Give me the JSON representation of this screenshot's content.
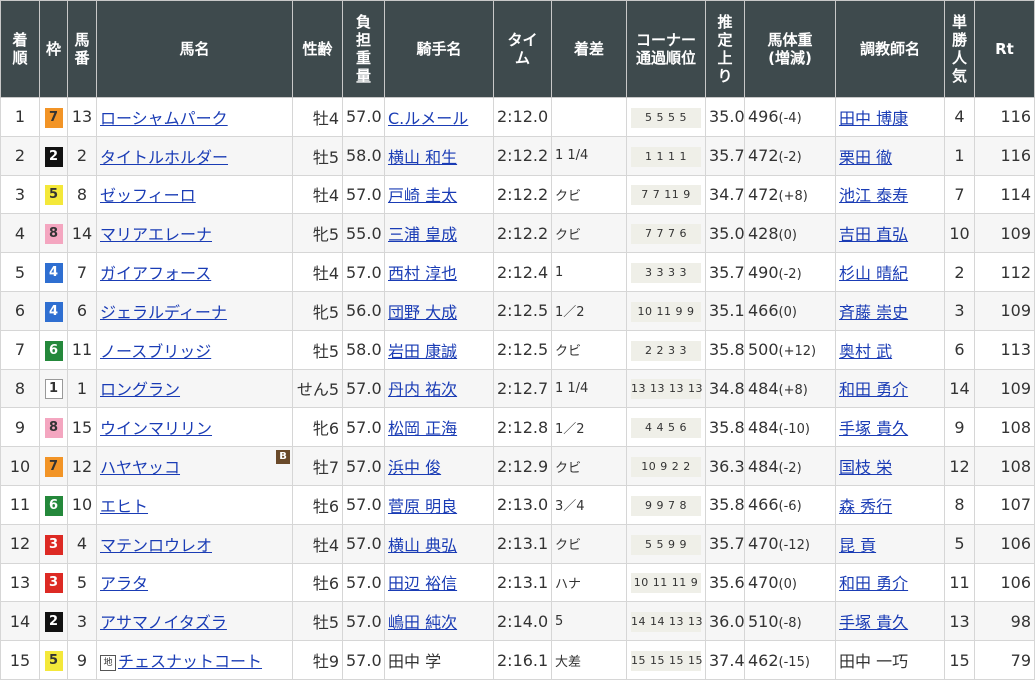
{
  "headers": [
    "着順",
    "枠",
    "馬番",
    "馬名",
    "性齢",
    "負担重量",
    "騎手名",
    "タイム",
    "着差",
    "コーナー通過順位",
    "推定上り",
    "馬体重(増減)",
    "調教師名",
    "単勝人気",
    "Rt"
  ],
  "header_display": {
    "rank": [
      "着",
      "順"
    ],
    "waku": [
      "枠"
    ],
    "num": [
      "馬",
      "番"
    ],
    "name": [
      "馬名"
    ],
    "sexage": [
      "性齢"
    ],
    "weight": [
      "負",
      "担",
      "重",
      "量"
    ],
    "jockey": [
      "騎手名"
    ],
    "time": [
      "タイ",
      "ム"
    ],
    "margin": [
      "着差"
    ],
    "corner": [
      "コーナー",
      "通過順位"
    ],
    "last3f": [
      "推",
      "定",
      "上",
      "り"
    ],
    "body": [
      "馬体重",
      "(増減)"
    ],
    "trainer": [
      "調教師名"
    ],
    "pop": [
      "単",
      "勝",
      "人",
      "気"
    ],
    "rt": [
      "Rt"
    ]
  },
  "rows": [
    {
      "rank": "1",
      "waku": "7",
      "num": "13",
      "name": "ローシャムパーク",
      "sexage": "牡4",
      "weight": "57.0",
      "jockey": "C.ルメール",
      "time": "2:12.0",
      "margin": "",
      "corner": "5 5 5 5",
      "last3f": "35.0",
      "body": "496",
      "diff": "(-4)",
      "trainer": "田中 博康",
      "pop": "4",
      "rt": "116",
      "jockey_link": true,
      "trainer_link": true
    },
    {
      "rank": "2",
      "waku": "2",
      "num": "2",
      "name": "タイトルホルダー",
      "sexage": "牡5",
      "weight": "58.0",
      "jockey": "横山 和生",
      "time": "2:12.2",
      "margin": "1 1/4",
      "corner": "1 1 1 1",
      "last3f": "35.7",
      "body": "472",
      "diff": "(-2)",
      "trainer": "栗田 徹",
      "pop": "1",
      "rt": "116",
      "jockey_link": true,
      "trainer_link": true
    },
    {
      "rank": "3",
      "waku": "5",
      "num": "8",
      "name": "ゼッフィーロ",
      "sexage": "牡4",
      "weight": "57.0",
      "jockey": "戸崎 圭太",
      "time": "2:12.2",
      "margin": "クビ",
      "corner": "7 7 11 9",
      "last3f": "34.7",
      "body": "472",
      "diff": "(+8)",
      "trainer": "池江 泰寿",
      "pop": "7",
      "rt": "114",
      "jockey_link": true,
      "trainer_link": true
    },
    {
      "rank": "4",
      "waku": "8",
      "num": "14",
      "name": "マリアエレーナ",
      "sexage": "牝5",
      "weight": "55.0",
      "jockey": "三浦 皇成",
      "time": "2:12.2",
      "margin": "クビ",
      "corner": "7 7 7 6",
      "last3f": "35.0",
      "body": "428",
      "diff": "(0)",
      "trainer": "吉田 直弘",
      "pop": "10",
      "rt": "109",
      "jockey_link": true,
      "trainer_link": true
    },
    {
      "rank": "5",
      "waku": "4",
      "num": "7",
      "name": "ガイアフォース",
      "sexage": "牡4",
      "weight": "57.0",
      "jockey": "西村 淳也",
      "time": "2:12.4",
      "margin": "1",
      "corner": "3 3 3 3",
      "last3f": "35.7",
      "body": "490",
      "diff": "(-2)",
      "trainer": "杉山 晴紀",
      "pop": "2",
      "rt": "112",
      "jockey_link": true,
      "trainer_link": true
    },
    {
      "rank": "6",
      "waku": "4",
      "num": "6",
      "name": "ジェラルディーナ",
      "sexage": "牝5",
      "weight": "56.0",
      "jockey": "団野 大成",
      "time": "2:12.5",
      "margin": "1／2",
      "corner": "10 11 9 9",
      "last3f": "35.1",
      "body": "466",
      "diff": "(0)",
      "trainer": "斉藤 崇史",
      "pop": "3",
      "rt": "109",
      "jockey_link": true,
      "trainer_link": true
    },
    {
      "rank": "7",
      "waku": "6",
      "num": "11",
      "name": "ノースブリッジ",
      "sexage": "牡5",
      "weight": "58.0",
      "jockey": "岩田 康誠",
      "time": "2:12.5",
      "margin": "クビ",
      "corner": "2 2 3 3",
      "last3f": "35.8",
      "body": "500",
      "diff": "(+12)",
      "trainer": "奥村 武",
      "pop": "6",
      "rt": "113",
      "jockey_link": true,
      "trainer_link": true
    },
    {
      "rank": "8",
      "waku": "1",
      "num": "1",
      "name": "ロングラン",
      "sexage": "せん5",
      "weight": "57.0",
      "jockey": "丹内 祐次",
      "time": "2:12.7",
      "margin": "1 1/4",
      "corner": "13 13 13 13",
      "last3f": "34.8",
      "body": "484",
      "diff": "(+8)",
      "trainer": "和田 勇介",
      "pop": "14",
      "rt": "109",
      "jockey_link": true,
      "trainer_link": true
    },
    {
      "rank": "9",
      "waku": "8",
      "num": "15",
      "name": "ウインマリリン",
      "sexage": "牝6",
      "weight": "57.0",
      "jockey": "松岡 正海",
      "time": "2:12.8",
      "margin": "1／2",
      "corner": "4 4 5 6",
      "last3f": "35.8",
      "body": "484",
      "diff": "(-10)",
      "trainer": "手塚 貴久",
      "pop": "9",
      "rt": "108",
      "jockey_link": true,
      "trainer_link": true
    },
    {
      "rank": "10",
      "waku": "7",
      "num": "12",
      "name": "ハヤヤッコ",
      "sexage": "牡7",
      "weight": "57.0",
      "jockey": "浜中 俊",
      "time": "2:12.9",
      "margin": "クビ",
      "corner": "10 9 2 2",
      "last3f": "36.3",
      "body": "484",
      "diff": "(-2)",
      "trainer": "国枝 栄",
      "pop": "12",
      "rt": "108",
      "jockey_link": true,
      "trainer_link": true,
      "blinker": "B"
    },
    {
      "rank": "11",
      "waku": "6",
      "num": "10",
      "name": "エヒト",
      "sexage": "牡6",
      "weight": "57.0",
      "jockey": "菅原 明良",
      "time": "2:13.0",
      "margin": "3／4",
      "corner": "9 9 7 8",
      "last3f": "35.8",
      "body": "466",
      "diff": "(-6)",
      "trainer": "森 秀行",
      "pop": "8",
      "rt": "107",
      "jockey_link": true,
      "trainer_link": true
    },
    {
      "rank": "12",
      "waku": "3",
      "num": "4",
      "name": "マテンロウレオ",
      "sexage": "牡4",
      "weight": "57.0",
      "jockey": "横山 典弘",
      "time": "2:13.1",
      "margin": "クビ",
      "corner": "5 5 9 9",
      "last3f": "35.7",
      "body": "470",
      "diff": "(-12)",
      "trainer": "昆 貢",
      "pop": "5",
      "rt": "106",
      "jockey_link": true,
      "trainer_link": true
    },
    {
      "rank": "13",
      "waku": "3",
      "num": "5",
      "name": "アラタ",
      "sexage": "牡6",
      "weight": "57.0",
      "jockey": "田辺 裕信",
      "time": "2:13.1",
      "margin": "ハナ",
      "corner": "10 11 11 9",
      "last3f": "35.6",
      "body": "470",
      "diff": "(0)",
      "trainer": "和田 勇介",
      "pop": "11",
      "rt": "106",
      "jockey_link": true,
      "trainer_link": true
    },
    {
      "rank": "14",
      "waku": "2",
      "num": "3",
      "name": "アサマノイタズラ",
      "sexage": "牡5",
      "weight": "57.0",
      "jockey": "嶋田 純次",
      "time": "2:14.0",
      "margin": "5",
      "corner": "14 14 13 13",
      "last3f": "36.0",
      "body": "510",
      "diff": "(-8)",
      "trainer": "手塚 貴久",
      "pop": "13",
      "rt": "98",
      "jockey_link": true,
      "trainer_link": true
    },
    {
      "rank": "15",
      "waku": "5",
      "num": "9",
      "name": "チェスナットコート",
      "sexage": "牡9",
      "weight": "57.0",
      "jockey": "田中 学",
      "time": "2:16.1",
      "margin": "大差",
      "corner": "15 15 15 15",
      "last3f": "37.4",
      "body": "462",
      "diff": "(-15)",
      "trainer": "田中 一巧",
      "pop": "15",
      "rt": "79",
      "jockey_link": false,
      "trainer_link": false,
      "mark": "地"
    }
  ],
  "colors": {
    "header_bg": "#3e4a4d",
    "link": "#1a3cb5",
    "waku1": "#ffffff",
    "waku2": "#111111",
    "waku3": "#dd2a24",
    "waku4": "#2f6fd1",
    "waku5": "#f4e83a",
    "waku6": "#24883b",
    "waku7": "#f29426",
    "waku8": "#f4a6c0"
  }
}
